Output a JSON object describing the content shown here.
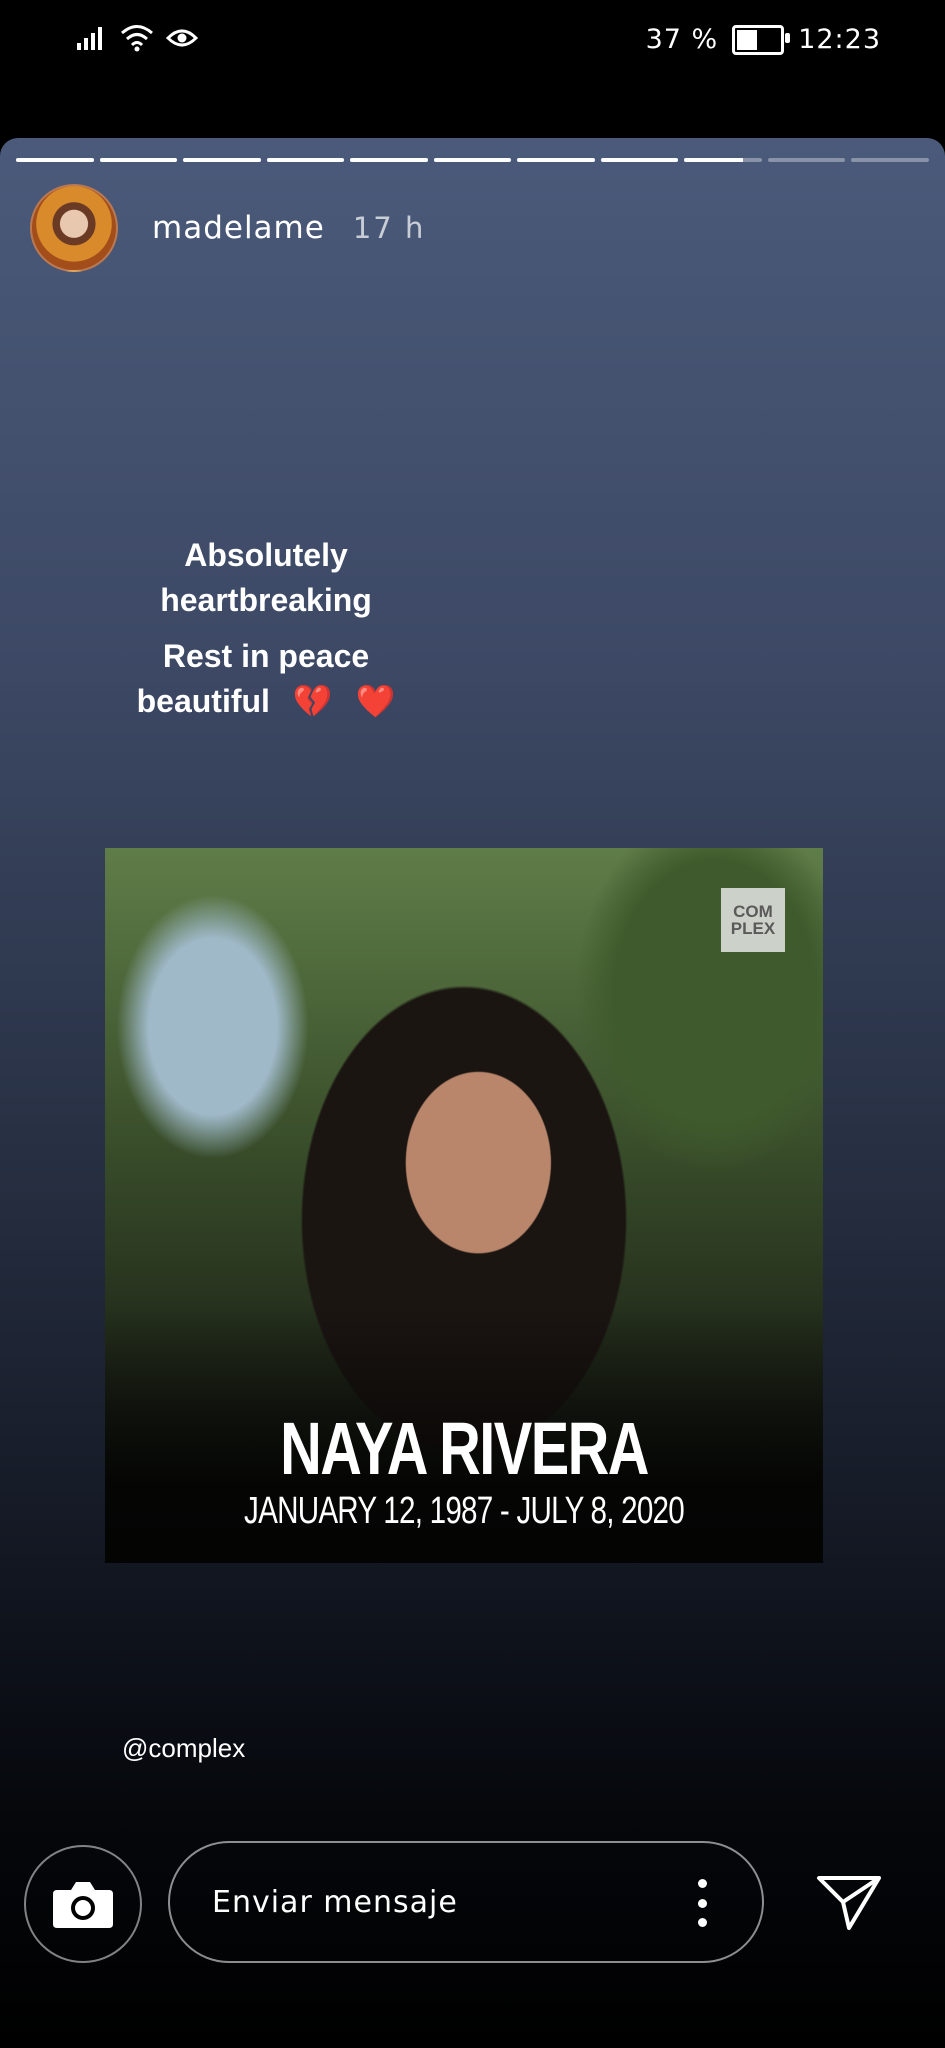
{
  "status_bar": {
    "battery": "37 %",
    "time": "12:23"
  },
  "story": {
    "progress": {
      "segments": 11,
      "current_index": 8,
      "current_fraction": 0.75
    },
    "username": "madelame",
    "time_ago": "17 h",
    "caption_lines": [
      "Absolutely heartbreaking",
      "Rest in peace beautiful"
    ],
    "caption_emoji": [
      "💔",
      "❤️"
    ],
    "shared_post": {
      "logo_text": [
        "COM",
        "PLEX"
      ],
      "name": "NAYA RIVERA",
      "dates": "JANUARY 12, 1987 - JULY 8, 2020"
    },
    "mention": "@complex"
  },
  "reply_bar": {
    "placeholder": "Enviar mensaje",
    "camera_icon": "camera-icon",
    "more_icon": "more-vertical-icon",
    "send_icon": "send-icon"
  },
  "colors": {
    "accent": "#ffffff",
    "background": "#000000"
  }
}
